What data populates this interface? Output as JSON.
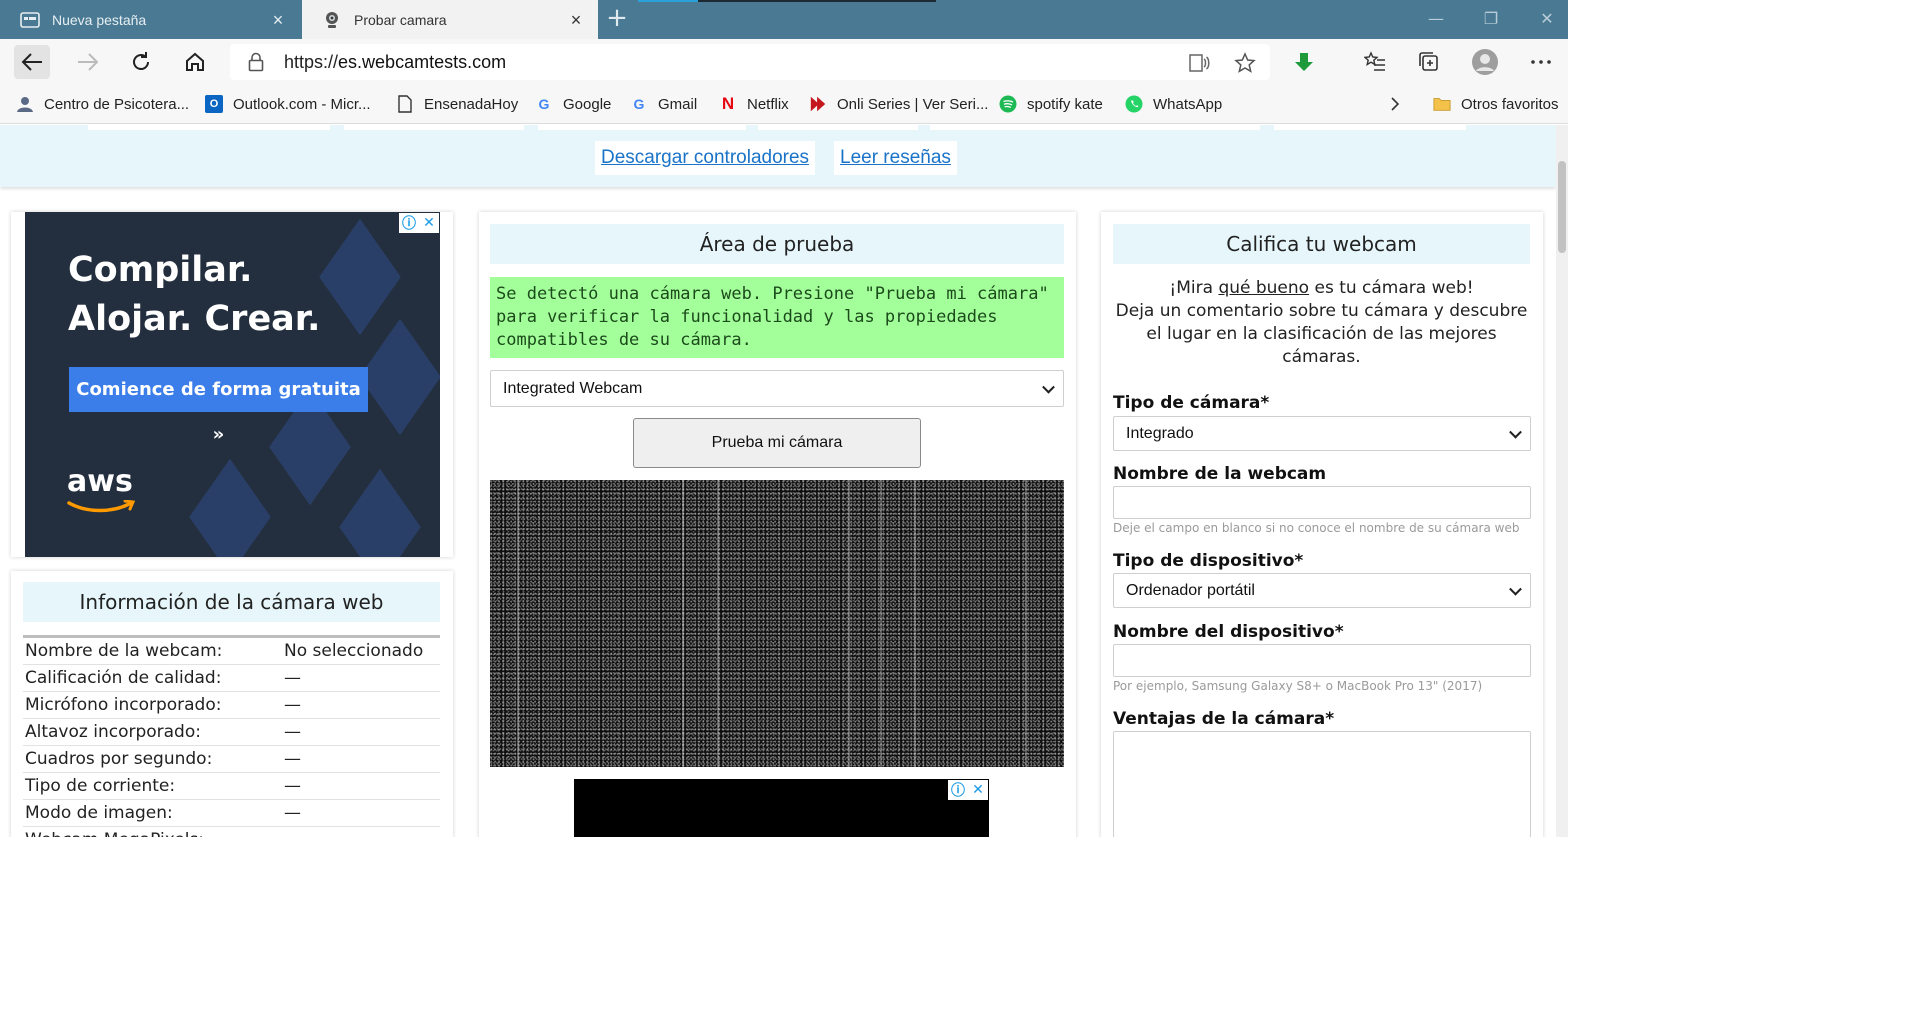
{
  "browser": {
    "tabs": [
      {
        "title": "Nueva pestaña",
        "active": false
      },
      {
        "title": "Probar camara",
        "active": true
      }
    ],
    "url": {
      "scheme": "https://",
      "host": "es.webcamtests.com"
    },
    "bookmarks": [
      {
        "label": "Centro de Psicotera...",
        "icon": "user-icon"
      },
      {
        "label": "Outlook.com - Micr...",
        "icon": "outlook-icon"
      },
      {
        "label": "EnsenadaHoy",
        "icon": "page-icon"
      },
      {
        "label": "Google",
        "icon": "google-icon"
      },
      {
        "label": "Gmail",
        "icon": "google-icon"
      },
      {
        "label": "Netflix",
        "icon": "netflix-icon"
      },
      {
        "label": "Onli Series | Ver Seri...",
        "icon": "play-icon"
      },
      {
        "label": "spotify kate",
        "icon": "spotify-icon"
      },
      {
        "label": "WhatsApp",
        "icon": "whatsapp-icon"
      }
    ],
    "other_favorites": "Otros favoritos",
    "accent": "#4a7a93"
  },
  "topnav": {
    "download_drivers": "Descargar controladores",
    "read_reviews": "Leer reseñas"
  },
  "ad": {
    "line1": "Compilar.",
    "line2": "Alojar. Crear.",
    "cta": "Comience de forma gratuita »",
    "brand": "aws"
  },
  "info": {
    "title": "Información de la cámara web",
    "rows": [
      {
        "key": "Nombre de la webcam:",
        "value": "No seleccionado"
      },
      {
        "key": "Calificación de calidad:",
        "value": "—"
      },
      {
        "key": "Micrófono incorporado:",
        "value": "—"
      },
      {
        "key": "Altavoz incorporado:",
        "value": "—"
      },
      {
        "key": "Cuadros por segundo:",
        "value": "—"
      },
      {
        "key": "Tipo de corriente:",
        "value": "—"
      },
      {
        "key": "Modo de imagen:",
        "value": "—"
      },
      {
        "key": "Webcam MegaPixels:",
        "value": "—"
      }
    ]
  },
  "test": {
    "title": "Área de prueba",
    "detected": "Se detectó una cámara web. Presione \"Prueba mi cámara\" para verificar la funcionalidad y las propiedades compatibles de su cámara.",
    "camera_selected": "Integrated Webcam",
    "button": "Prueba mi cámara"
  },
  "rate": {
    "title": "Califica tu webcam",
    "intro_a": "¡Mira ",
    "intro_link": "qué bueno",
    "intro_b": " es tu cámara web!",
    "intro_c": "Deja un comentario sobre tu cámara y descubre el lugar en la clasificación de las mejores cámaras.",
    "camera_type_label": "Tipo de cámara*",
    "camera_type_value": "Integrado",
    "webcam_name_label": "Nombre de la webcam",
    "webcam_name_value": "",
    "webcam_name_hint": "Deje el campo en blanco si no conoce el nombre de su cámara web",
    "device_type_label": "Tipo de dispositivo*",
    "device_type_value": "Ordenador portátil",
    "device_name_label": "Nombre del dispositivo*",
    "device_name_value": "",
    "device_name_hint": "Por ejemplo, Samsung Galaxy S8+ o MacBook Pro 13\" (2017)",
    "advantages_label": "Ventajas de la cámara*",
    "advantages_value": ""
  }
}
